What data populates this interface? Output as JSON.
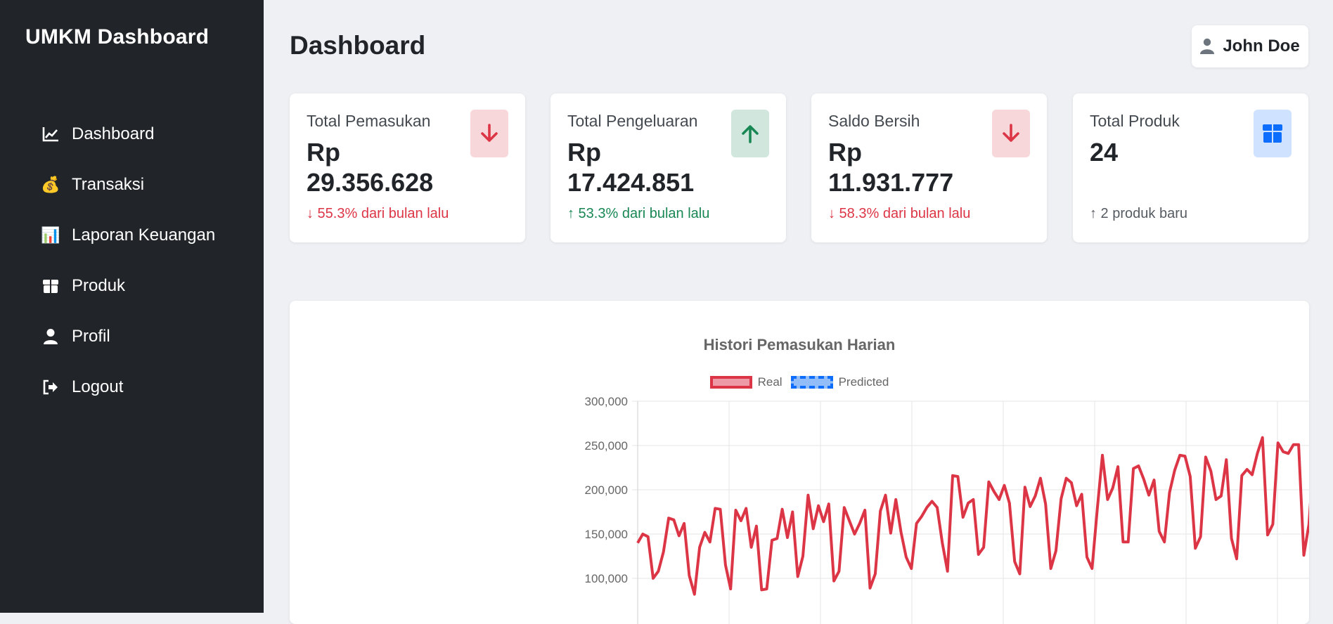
{
  "sidebar": {
    "brand": "UMKM Dashboard",
    "items": [
      {
        "label": "Dashboard",
        "icon": "chart-line-icon"
      },
      {
        "label": "Transaksi",
        "icon": "money-bag-icon"
      },
      {
        "label": "Laporan Keuangan",
        "icon": "bar-chart-icon"
      },
      {
        "label": "Produk",
        "icon": "box-icon"
      },
      {
        "label": "Profil",
        "icon": "user-icon"
      },
      {
        "label": "Logout",
        "icon": "logout-icon"
      }
    ]
  },
  "header": {
    "title": "Dashboard",
    "user": "John Doe"
  },
  "cards": [
    {
      "label": "Total Pemasukan",
      "value": "Rp 29.356.628",
      "note": "↓ 55.3% dari bulan lalu",
      "trend": "down",
      "icon": "arrow-down-icon"
    },
    {
      "label": "Total Pengeluaran",
      "value": "Rp 17.424.851",
      "note": "↑ 53.3% dari bulan lalu",
      "trend": "up",
      "icon": "arrow-up-icon"
    },
    {
      "label": "Saldo Bersih",
      "value": "Rp 11.931.777",
      "note": "↓ 58.3% dari bulan lalu",
      "trend": "down",
      "icon": "arrow-down-icon"
    },
    {
      "label": "Total Produk",
      "value": "24",
      "note": "↑ 2 produk baru",
      "trend": "neutral",
      "icon": "box-icon"
    }
  ],
  "colors": {
    "sidebar_bg": "#212529",
    "page_bg": "#eef0f4",
    "danger": "#dc3545",
    "success": "#198754",
    "primary": "#0d6efd"
  },
  "chart_data": {
    "type": "line",
    "title": "Histori Pemasukan Harian",
    "legend_position": "top",
    "grid": true,
    "ylim": [
      50000,
      300000
    ],
    "yticks": [
      "300,000",
      "250,000",
      "200,000",
      "150,000",
      "100,000"
    ],
    "series": [
      {
        "name": "Real",
        "color": "#dc3545",
        "style": "solid",
        "x_start": 0,
        "values": [
          140000,
          150000,
          147000,
          100000,
          108000,
          130000,
          168000,
          166000,
          148000,
          162000,
          103000,
          82000,
          135000,
          152000,
          141000,
          179000,
          178000,
          115000,
          88000,
          177000,
          165000,
          179000,
          135000,
          159000,
          87000,
          88000,
          143000,
          145000,
          178000,
          146000,
          175000,
          102000,
          125000,
          194000,
          156000,
          182000,
          164000,
          184000,
          97000,
          108000,
          180000,
          165000,
          150000,
          162000,
          177000,
          89000,
          105000,
          176000,
          194000,
          151000,
          189000,
          152000,
          124000,
          111000,
          162000,
          170000,
          180000,
          187000,
          180000,
          140000,
          108000,
          216000,
          215000,
          169000,
          185000,
          189000,
          127000,
          135000,
          209000,
          198000,
          189000,
          205000,
          185000,
          119000,
          105000,
          203000,
          181000,
          193000,
          213000,
          184000,
          111000,
          131000,
          190000,
          213000,
          208000,
          182000,
          195000,
          124000,
          111000,
          178000,
          239000,
          189000,
          202000,
          226000,
          141000,
          141000,
          224000,
          227000,
          212000,
          194000,
          211000,
          153000,
          141000,
          197000,
          222000,
          239000,
          238000,
          215000,
          134000,
          147000,
          237000,
          221000,
          189000,
          193000,
          234000,
          145000,
          122000,
          216000,
          223000,
          217000,
          241000,
          259000,
          149000,
          161000,
          253000,
          243000,
          241000,
          251000,
          251000,
          126000,
          161000,
          244000,
          216000,
          254000,
          217000,
          220000,
          129000,
          125000,
          258000,
          224000,
          242000,
          222000,
          214000,
          147000,
          129000,
          216000,
          221000,
          249000,
          252000,
          215000,
          146000,
          154000,
          261000,
          237000,
          262000,
          229000,
          259000,
          156000,
          130000,
          243000,
          272000,
          235000,
          233000,
          230000
        ]
      },
      {
        "name": "Predicted",
        "color": "#0d6efd",
        "style": "dashed",
        "x_start": 163,
        "values": [
          230000,
          226000,
          218000,
          226000,
          236000,
          228000,
          232000,
          244000,
          255000,
          245000,
          244000,
          246000,
          250000,
          255000,
          249000
        ]
      }
    ]
  }
}
